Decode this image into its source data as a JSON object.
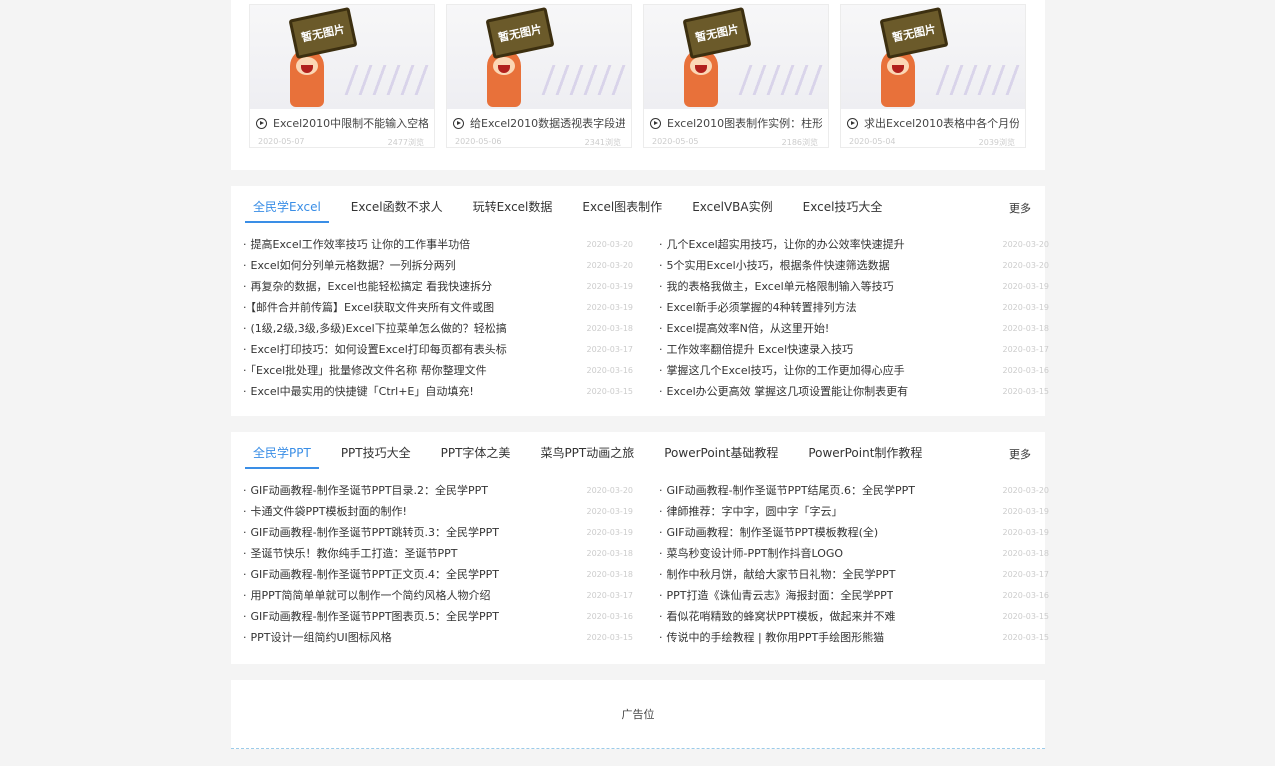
{
  "cards": [
    {
      "placeholder": "暂无图片",
      "title": "Excel2010中限制不能输入空格...",
      "date": "2020-05-07",
      "views": "2477浏览"
    },
    {
      "placeholder": "暂无图片",
      "title": "给Excel2010数据透视表字段进...",
      "date": "2020-05-06",
      "views": "2341浏览"
    },
    {
      "placeholder": "暂无图片",
      "title": "Excel2010图表制作实例：柱形...",
      "date": "2020-05-05",
      "views": "2186浏览"
    },
    {
      "placeholder": "暂无图片",
      "title": "求出Excel2010表格中各个月份...",
      "date": "2020-05-04",
      "views": "2039浏览"
    }
  ],
  "excel": {
    "tabs": [
      "全民学Excel",
      "Excel函数不求人",
      "玩转Excel数据",
      "Excel图表制作",
      "ExcelVBA实例",
      "Excel技巧大全"
    ],
    "more": "更多",
    "left": [
      {
        "title": "提高Excel工作效率技巧 让你的工作事半功倍",
        "date": "2020-03-20"
      },
      {
        "title": "Excel如何分列单元格数据？一列拆分两列",
        "date": "2020-03-20"
      },
      {
        "title": "再复杂的数据，Excel也能轻松搞定 看我快速拆分",
        "date": "2020-03-19"
      },
      {
        "title": "【邮件合并前传篇】Excel获取文件夹所有文件或图",
        "date": "2020-03-19"
      },
      {
        "title": "(1级,2级,3级,多级)Excel下拉菜单怎么做的？轻松搞",
        "date": "2020-03-18"
      },
      {
        "title": "Excel打印技巧：如何设置Excel打印每页都有表头标",
        "date": "2020-03-17"
      },
      {
        "title": "「Excel批处理」批量修改文件名称  帮你整理文件",
        "date": "2020-03-16"
      },
      {
        "title": "Excel中最实用的快捷键「Ctrl+E」自动填充!",
        "date": "2020-03-15"
      }
    ],
    "right": [
      {
        "title": "几个Excel超实用技巧，让你的办公效率快速提升",
        "date": "2020-03-20"
      },
      {
        "title": "5个实用Excel小技巧，根据条件快速筛选数据",
        "date": "2020-03-20"
      },
      {
        "title": "我的表格我做主，Excel单元格限制输入等技巧",
        "date": "2020-03-19"
      },
      {
        "title": "Excel新手必须掌握的4种转置排列方法",
        "date": "2020-03-19"
      },
      {
        "title": "Excel提高效率N倍，从这里开始!",
        "date": "2020-03-18"
      },
      {
        "title": "工作效率翻倍提升 Excel快速录入技巧",
        "date": "2020-03-17"
      },
      {
        "title": "掌握这几个Excel技巧，让你的工作更加得心应手",
        "date": "2020-03-16"
      },
      {
        "title": "Excel办公更高效 掌握这几项设置能让你制表更有",
        "date": "2020-03-15"
      }
    ]
  },
  "ppt": {
    "tabs": [
      "全民学PPT",
      "PPT技巧大全",
      "PPT字体之美",
      "菜鸟PPT动画之旅",
      "PowerPoint基础教程",
      "PowerPoint制作教程"
    ],
    "more": "更多",
    "left": [
      {
        "title": "GIF动画教程-制作圣诞节PPT目录.2：全民学PPT",
        "date": "2020-03-20"
      },
      {
        "title": "卡通文件袋PPT模板封面的制作!",
        "date": "2020-03-19"
      },
      {
        "title": "GIF动画教程-制作圣诞节PPT跳转页.3：全民学PPT",
        "date": "2020-03-19"
      },
      {
        "title": "圣诞节快乐！教你纯手工打造：圣诞节PPT",
        "date": "2020-03-18"
      },
      {
        "title": "GIF动画教程-制作圣诞节PPT正文页.4：全民学PPT",
        "date": "2020-03-18"
      },
      {
        "title": "用PPT简简单单就可以制作一个简约风格人物介绍",
        "date": "2020-03-17"
      },
      {
        "title": "GIF动画教程-制作圣诞节PPT图表页.5：全民学PPT",
        "date": "2020-03-16"
      },
      {
        "title": "PPT设计一组简约UI图标风格",
        "date": "2020-03-15"
      }
    ],
    "right": [
      {
        "title": "GIF动画教程-制作圣诞节PPT结尾页.6：全民学PPT",
        "date": "2020-03-20"
      },
      {
        "title": "律師推荐：字中字，圆中字「字云」",
        "date": "2020-03-19"
      },
      {
        "title": "GIF动画教程：制作圣诞节PPT模板教程(全)",
        "date": "2020-03-19"
      },
      {
        "title": "菜鸟秒变设计师-PPT制作抖音LOGO",
        "date": "2020-03-18"
      },
      {
        "title": "制作中秋月饼，献给大家节日礼物：全民学PPT",
        "date": "2020-03-17"
      },
      {
        "title": "PPT打造《诛仙青云志》海报封面：全民学PPT",
        "date": "2020-03-16"
      },
      {
        "title": "看似花哨精致的蜂窝状PPT模板，做起来并不难",
        "date": "2020-03-15"
      },
      {
        "title": "传说中的手绘教程 | 教你用PPT手绘图形熊猫",
        "date": "2020-03-15"
      }
    ]
  },
  "ad": {
    "label": "广告位"
  }
}
